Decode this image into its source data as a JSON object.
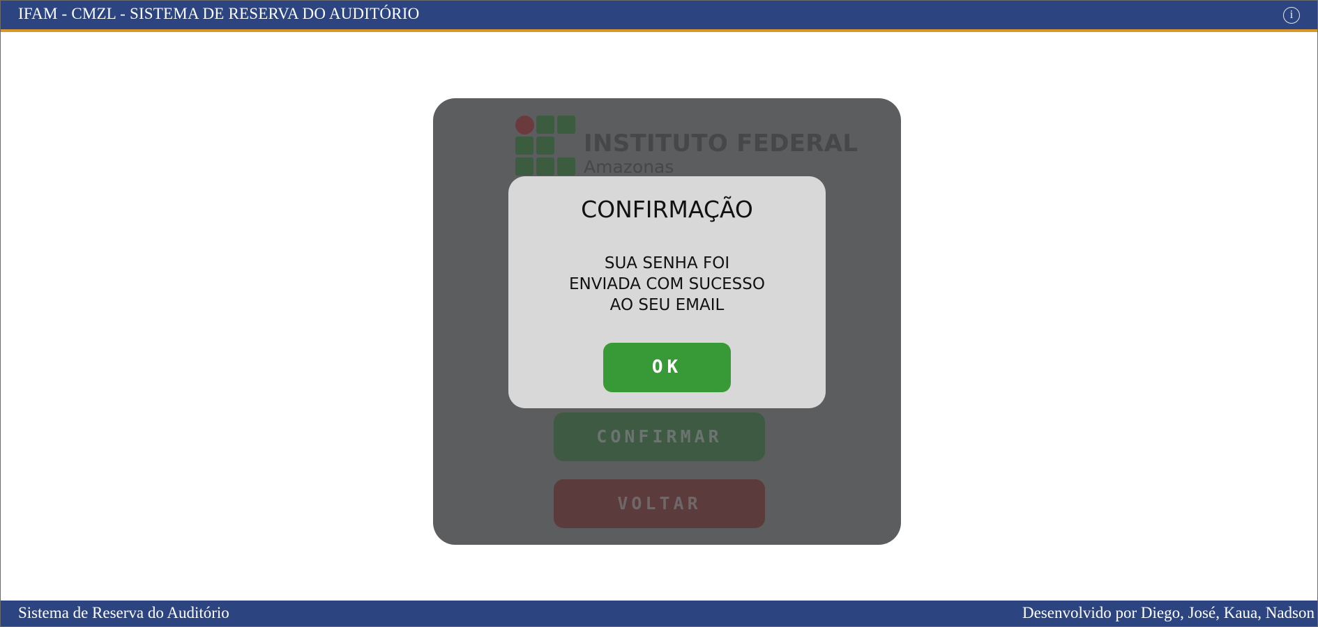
{
  "header": {
    "title": "IFAM - CMZL - SISTEMA DE RESERVA DO AUDITÓRIO",
    "info_icon": "info-icon",
    "info_glyph": "i"
  },
  "background_card": {
    "logo_title": "INSTITUTO FEDERAL",
    "logo_subtitle": "Amazonas",
    "confirm_label": "CONFIRMAR",
    "back_label": "VOLTAR"
  },
  "modal": {
    "title": "CONFIRMAÇÃO",
    "message_lines": [
      "SUA SENHA FOI",
      "ENVIADA COM SUCESSO",
      "AO SEU EMAIL"
    ],
    "ok_label": "OK"
  },
  "footer": {
    "left_text": "Sistema de Reserva do Auditório",
    "right_text": "Desenvolvido por Diego, José, Kaua, Nadson"
  },
  "colors": {
    "header_bg": "#2c4581",
    "header_accent": "#d9962b",
    "ok_green": "#389a37",
    "modal_bg": "#d8d8d8",
    "overlay_card": "#5c5d5f"
  }
}
